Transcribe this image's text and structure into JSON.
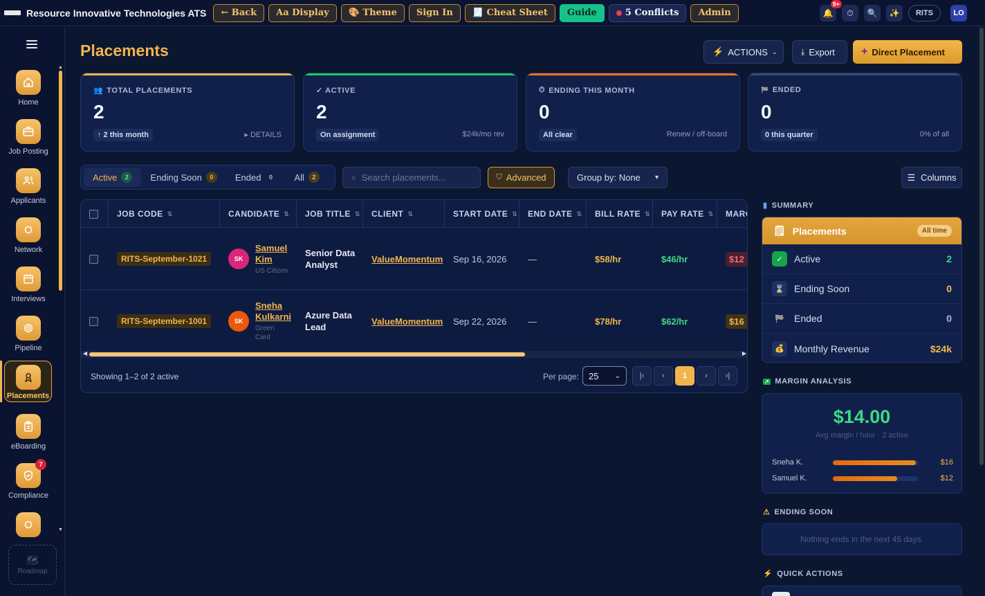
{
  "topbar": {
    "app_title": "Resource Innovative Technologies ATS",
    "buttons": {
      "back": "← Back",
      "display": "Aa Display",
      "theme": "🎨 Theme",
      "signin": "Sign In",
      "cheatsheet": "🧾 Cheat Sheet",
      "guide": "Guide",
      "conflicts": "5 Conflicts",
      "admin": "Admin"
    },
    "notif_badge": "9+",
    "org": "RITS",
    "user_initials": "LO"
  },
  "sidebar": {
    "items": [
      {
        "label": "Home",
        "icon": "home-icon"
      },
      {
        "label": "Job Posting",
        "icon": "briefcase-icon"
      },
      {
        "label": "Applicants",
        "icon": "users-icon"
      },
      {
        "label": "Network",
        "icon": "circle-icon"
      },
      {
        "label": "Interviews",
        "icon": "calendar-icon"
      },
      {
        "label": "Pipeline",
        "icon": "target-icon"
      },
      {
        "label": "Placements",
        "icon": "award-icon"
      },
      {
        "label": "eBoarding",
        "icon": "clipboard-icon"
      },
      {
        "label": "Compliance",
        "icon": "shield-icon",
        "badge": "7"
      }
    ],
    "roadmap": "Roadmap",
    "accent": "#f0b54d"
  },
  "header": {
    "title": "Placements",
    "actions_label": "ACTIONS",
    "export_label": "Export",
    "direct_label": "Direct Placement"
  },
  "stats": [
    {
      "label": "TOTAL PLACEMENTS",
      "icon": "👥",
      "value": "2",
      "sub": "↑ 2 this month",
      "right": "▸ DETAILS",
      "color": "#f0b54d"
    },
    {
      "label": "✓ ACTIVE",
      "icon": "",
      "value": "2",
      "sub": "On assignment",
      "right": "$24k/mo rev",
      "color": "#22c55e"
    },
    {
      "label": "ENDING THIS MONTH",
      "icon": "⏱",
      "value": "0",
      "sub": "All clear",
      "right": "Renew / off-board",
      "color": "#f97316"
    },
    {
      "label": "ENDED",
      "icon": "🏁",
      "value": "0",
      "sub": "0 this quarter",
      "right": "0% of all",
      "color": "#3b4a70"
    }
  ],
  "tabs": [
    {
      "label": "Active",
      "count": "2"
    },
    {
      "label": "Ending Soon",
      "count": "0"
    },
    {
      "label": "Ended",
      "count": "0"
    },
    {
      "label": "All",
      "count": "2"
    }
  ],
  "search": {
    "placeholder": "Search placements..."
  },
  "filters": {
    "advanced": "Advanced",
    "group_by": "Group by: None",
    "columns": "Columns"
  },
  "table": {
    "headers": [
      "JOB CODE",
      "CANDIDATE",
      "JOB TITLE",
      "CLIENT",
      "START DATE",
      "END DATE",
      "BILL RATE",
      "PAY RATE",
      "MARGIN"
    ],
    "rows": [
      {
        "job_code": "RITS-September-1021",
        "initials": "SK",
        "name_l1": "Samuel",
        "name_l2": "Kim",
        "sub_l1": "US Citizen",
        "sub_l2": "",
        "title_l1": "Senior Data",
        "title_l2": "Analyst",
        "client": "ValueMomentum",
        "start": "Sep 16, 2026",
        "end": "—",
        "bill": "$58/hr",
        "pay": "$46/hr",
        "margin": "$12"
      },
      {
        "job_code": "RITS-September-1001",
        "initials": "SK",
        "name_l1": "Sneha",
        "name_l2": "Kulkarni",
        "sub_l1": "Green",
        "sub_l2": "Card",
        "title_l1": "Azure Data",
        "title_l2": "Lead",
        "client": "ValueMomentum",
        "start": "Sep 22, 2026",
        "end": "—",
        "bill": "$78/hr",
        "pay": "$62/hr",
        "margin": "$16"
      }
    ],
    "scroll_fraction": 0.67,
    "showing": "Showing 1–2 of 2 active",
    "per_page_label": "Per page:",
    "per_page": "25",
    "pager": {
      "first": "|‹",
      "prev": "‹",
      "current": "1",
      "next": "›",
      "last": "›|"
    }
  },
  "summary": {
    "heading": "SUMMARY",
    "card_title": "Placements",
    "pill": "All time",
    "rows": [
      {
        "label": "Active",
        "value": "2",
        "color": "#3fd986"
      },
      {
        "label": "Ending Soon",
        "value": "0",
        "color": "#f0b54d"
      },
      {
        "label": "Ended",
        "value": "0",
        "color": "#aeb9d4"
      },
      {
        "label": "Monthly Revenue",
        "value": "$24k",
        "color": "#f0b54d"
      }
    ]
  },
  "margin": {
    "heading": "MARGIN ANALYSIS",
    "value": "$14.00",
    "sub": "Avg margin / hour · 2 active",
    "bars": [
      {
        "name": "Sneha K.",
        "amount": "$16",
        "fraction": 0.97
      },
      {
        "name": "Samuel K.",
        "amount": "$12",
        "fraction": 0.75
      }
    ]
  },
  "ending_soon": {
    "heading": "ENDING SOON",
    "empty": "Nothing ends in the next 45 days."
  },
  "quick_actions": {
    "heading": "QUICK ACTIONS"
  }
}
